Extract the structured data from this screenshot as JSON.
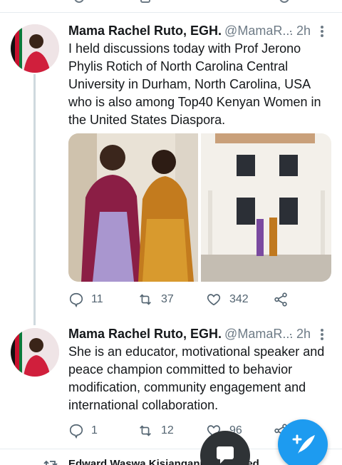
{
  "tweets": [
    {
      "author": "Mama Rachel Ruto, EGH.",
      "handle": "@MamaR...",
      "time": "· 2h",
      "text": "I held discussions today with Prof Jerono Phylis Rotich of North Carolina Central University in Durham, North Carolina, USA who is also among Top40 Kenyan Women in the United States Diaspora.",
      "replies": "11",
      "retweets": "37",
      "likes": "342"
    },
    {
      "author": "Mama Rachel Ruto, EGH.",
      "handle": "@MamaR...",
      "time": "· 2h",
      "text": "She is an educator, motivational speaker and peace champion committed to behavior modification, community engagement and international collaboration.",
      "replies": "1",
      "retweets": "12",
      "likes": "96"
    }
  ],
  "next_tweet": {
    "context_line": "Edward Waswa Kisiangani Retweeted"
  },
  "colors": {
    "accent": "#1d9bf0",
    "muted": "#6e7b86",
    "text": "#14171a"
  },
  "icons": [
    "reply-icon",
    "retweet-icon",
    "like-icon",
    "share-icon",
    "more-icon",
    "compose-icon",
    "messages-icon"
  ]
}
